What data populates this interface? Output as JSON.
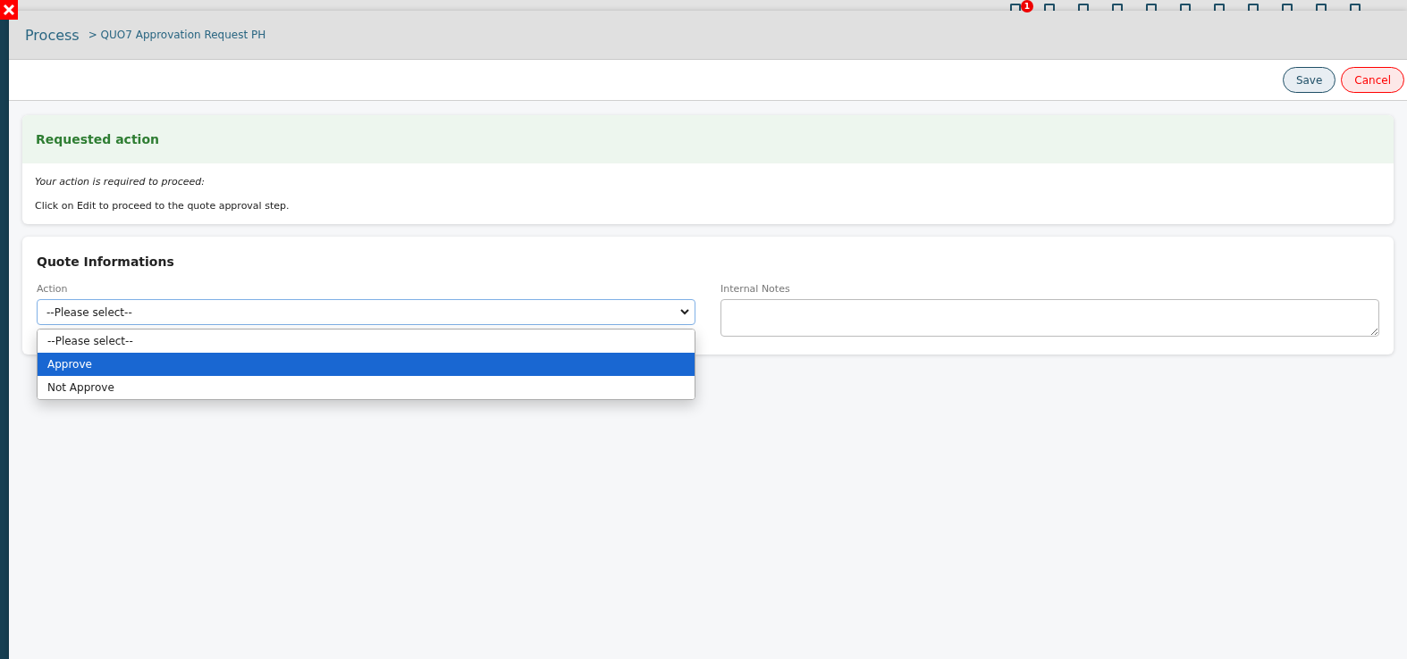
{
  "background": {
    "notification_count": "1"
  },
  "header": {
    "title": "Process",
    "breadcrumb": "> QUO7 Approvation Request PH"
  },
  "toolbar": {
    "buttons": [
      {
        "label": "Save",
        "kind": "primary"
      },
      {
        "label": "Cancel",
        "kind": "danger"
      }
    ]
  },
  "requested_action": {
    "title": "Requested action",
    "note": "Your action is required to proceed:",
    "message": "Click on Edit to proceed to the quote approval step."
  },
  "quote_informations": {
    "title": "Quote Informations",
    "action": {
      "label": "Action",
      "value": "--Please select--",
      "expanded": true,
      "options": [
        {
          "label": "--Please select--",
          "highlighted": false
        },
        {
          "label": "Approve",
          "highlighted": true
        },
        {
          "label": "Not Approve",
          "highlighted": false
        }
      ]
    },
    "internal_notes": {
      "label": "Internal Notes"
    }
  }
}
